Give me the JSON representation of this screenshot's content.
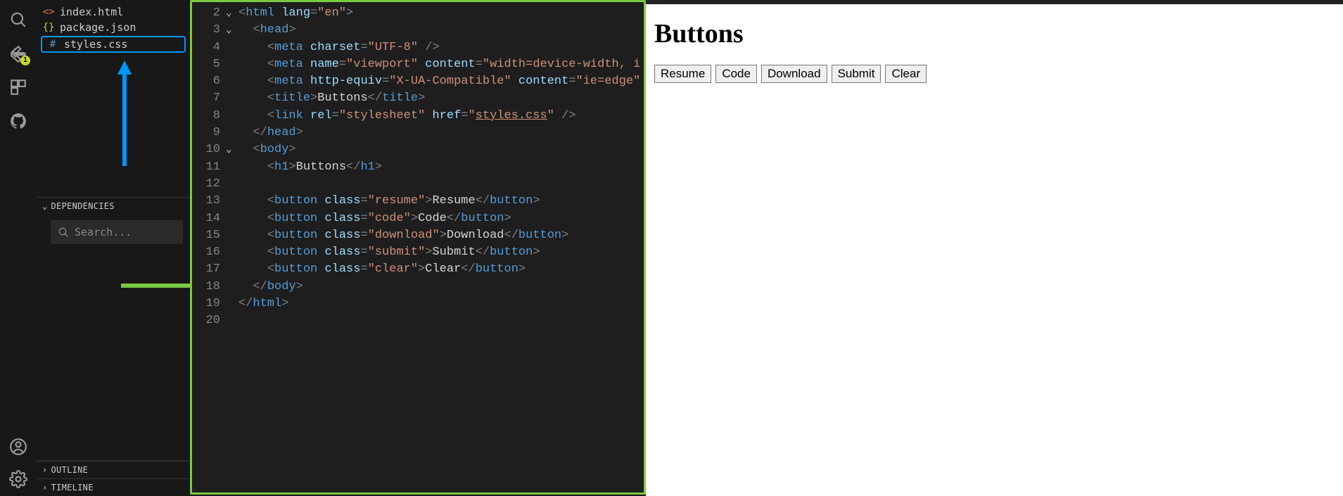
{
  "sidebar": {
    "files": [
      {
        "icon": "<>",
        "name": "index.html"
      },
      {
        "icon": "{}",
        "name": "package.json"
      },
      {
        "icon": "#",
        "name": "styles.css"
      }
    ],
    "dependencies_label": "DEPENDENCIES",
    "search_placeholder": "Search...",
    "outline_label": "OUTLINE",
    "timeline_label": "TIMELINE",
    "badge_count": "1"
  },
  "editor": {
    "lines": [
      {
        "n": "2",
        "fold": "⌄",
        "html": "<span class='t-pun'>&lt;</span><span class='t-tag'>html</span> <span class='t-attr'>lang</span><span class='t-pun'>=</span><span class='t-str'>\"en\"</span><span class='t-pun'>&gt;</span>"
      },
      {
        "n": "3",
        "fold": "⌄",
        "html": "  <span class='t-pun'>&lt;</span><span class='t-tag'>head</span><span class='t-pun'>&gt;</span>"
      },
      {
        "n": "4",
        "fold": "",
        "html": "    <span class='t-pun'>&lt;</span><span class='t-tag'>meta</span> <span class='t-attr'>charset</span><span class='t-pun'>=</span><span class='t-str'>\"UTF-8\"</span> <span class='t-pun'>/&gt;</span>"
      },
      {
        "n": "5",
        "fold": "",
        "html": "    <span class='t-pun'>&lt;</span><span class='t-tag'>meta</span> <span class='t-attr'>name</span><span class='t-pun'>=</span><span class='t-str'>\"viewport\"</span> <span class='t-attr'>content</span><span class='t-pun'>=</span><span class='t-str'>\"width=device-width, i</span>"
      },
      {
        "n": "6",
        "fold": "",
        "html": "    <span class='t-pun'>&lt;</span><span class='t-tag'>meta</span> <span class='t-attr'>http-equiv</span><span class='t-pun'>=</span><span class='t-str'>\"X-UA-Compatible\"</span> <span class='t-attr'>content</span><span class='t-pun'>=</span><span class='t-str'>\"ie=edge\"</span>"
      },
      {
        "n": "7",
        "fold": "",
        "html": "    <span class='t-pun'>&lt;</span><span class='t-tag'>title</span><span class='t-pun'>&gt;</span><span class='t-txt'>Buttons</span><span class='t-pun'>&lt;/</span><span class='t-tag'>title</span><span class='t-pun'>&gt;</span>"
      },
      {
        "n": "8",
        "fold": "",
        "html": "    <span class='t-pun'>&lt;</span><span class='t-tag'>link</span> <span class='t-attr'>rel</span><span class='t-pun'>=</span><span class='t-str'>\"stylesheet\"</span> <span class='t-attr'>href</span><span class='t-pun'>=</span><span class='t-str'>\"<span class='underline'>styles.css</span>\"</span> <span class='t-pun'>/&gt;</span>"
      },
      {
        "n": "9",
        "fold": "",
        "html": "  <span class='t-pun'>&lt;/</span><span class='t-tag'>head</span><span class='t-pun'>&gt;</span>"
      },
      {
        "n": "10",
        "fold": "⌄",
        "html": "  <span class='t-pun'>&lt;</span><span class='t-tag'>body</span><span class='t-pun'>&gt;</span>"
      },
      {
        "n": "11",
        "fold": "",
        "html": "    <span class='t-pun'>&lt;</span><span class='t-tag'>h1</span><span class='t-pun'>&gt;</span><span class='t-txt'>Buttons</span><span class='t-pun'>&lt;/</span><span class='t-tag'>h1</span><span class='t-pun'>&gt;</span>"
      },
      {
        "n": "12",
        "fold": "",
        "html": ""
      },
      {
        "n": "13",
        "fold": "",
        "html": "    <span class='t-pun'>&lt;</span><span class='t-tag'>button</span> <span class='t-attr'>class</span><span class='t-pun'>=</span><span class='t-str'>\"resume\"</span><span class='t-pun'>&gt;</span><span class='t-txt'>Resume</span><span class='t-pun'>&lt;/</span><span class='t-tag'>button</span><span class='t-pun'>&gt;</span>"
      },
      {
        "n": "14",
        "fold": "",
        "html": "    <span class='t-pun'>&lt;</span><span class='t-tag'>button</span> <span class='t-attr'>class</span><span class='t-pun'>=</span><span class='t-str'>\"code\"</span><span class='t-pun'>&gt;</span><span class='t-txt'>Code</span><span class='t-pun'>&lt;/</span><span class='t-tag'>button</span><span class='t-pun'>&gt;</span>"
      },
      {
        "n": "15",
        "fold": "",
        "html": "    <span class='t-pun'>&lt;</span><span class='t-tag'>button</span> <span class='t-attr'>class</span><span class='t-pun'>=</span><span class='t-str'>\"download\"</span><span class='t-pun'>&gt;</span><span class='t-txt'>Download</span><span class='t-pun'>&lt;/</span><span class='t-tag'>button</span><span class='t-pun'>&gt;</span>"
      },
      {
        "n": "16",
        "fold": "",
        "html": "    <span class='t-pun'>&lt;</span><span class='t-tag'>button</span> <span class='t-attr'>class</span><span class='t-pun'>=</span><span class='t-str'>\"submit\"</span><span class='t-pun'>&gt;</span><span class='t-txt'>Submit</span><span class='t-pun'>&lt;/</span><span class='t-tag'>button</span><span class='t-pun'>&gt;</span>"
      },
      {
        "n": "17",
        "fold": "",
        "html": "    <span class='t-pun'>&lt;</span><span class='t-tag'>button</span> <span class='t-attr'>class</span><span class='t-pun'>=</span><span class='t-str'>\"clear\"</span><span class='t-pun'>&gt;</span><span class='t-txt'>Clear</span><span class='t-pun'>&lt;/</span><span class='t-tag'>button</span><span class='t-pun'>&gt;</span>"
      },
      {
        "n": "18",
        "fold": "",
        "html": "  <span class='t-pun'>&lt;/</span><span class='t-tag'>body</span><span class='t-pun'>&gt;</span>"
      },
      {
        "n": "19",
        "fold": "",
        "html": "<span class='t-pun'>&lt;/</span><span class='t-tag'>html</span><span class='t-pun'>&gt;</span>"
      },
      {
        "n": "20",
        "fold": "",
        "html": ""
      }
    ]
  },
  "preview": {
    "heading": "Buttons",
    "buttons": [
      "Resume",
      "Code",
      "Download",
      "Submit",
      "Clear"
    ]
  }
}
